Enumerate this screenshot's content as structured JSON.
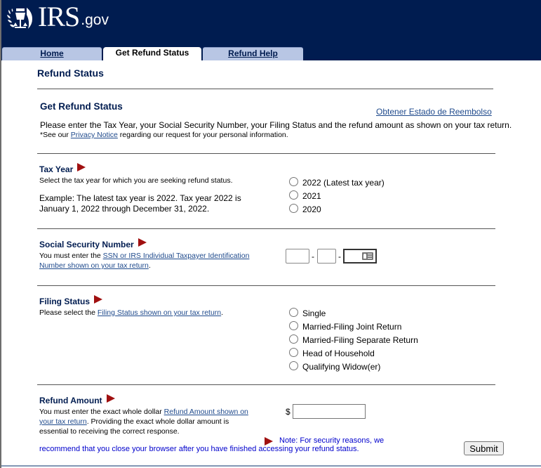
{
  "header": {
    "logo_text": "IRS",
    "logo_suffix": ".gov",
    "logo_icon": "irs-eagle-icon",
    "colors": {
      "navy": "#001c50",
      "tab_inactive": "#b8c6e4",
      "arrow_red": "#a01010",
      "link": "#1f4a8c",
      "note_blue": "#0000cc"
    }
  },
  "tabs": [
    {
      "label": "Home",
      "active": false
    },
    {
      "label": "Get Refund Status",
      "active": true
    },
    {
      "label": "Refund Help",
      "active": false
    }
  ],
  "page": {
    "title": "Refund Status",
    "section_title": "Get Refund Status",
    "spanish_link": "Obtener Estado de Reembolso",
    "intro": "Please enter the Tax Year, your Social Security Number, your Filing Status and the refund amount as shown on your tax return.",
    "privacy_prefix": "*See our ",
    "privacy_link": "Privacy Notice",
    "privacy_suffix": " regarding our request for your personal information."
  },
  "tax_year": {
    "label": "Tax Year",
    "help": "Select the tax year for which you are seeking refund status.",
    "example_line1": "Example: The latest tax year is 2022. Tax year 2022 is",
    "example_line2": "January 1, 2022 through December 31, 2022.",
    "options": [
      "2022 (Latest tax year)",
      "2021",
      "2020"
    ]
  },
  "ssn": {
    "label": "Social Security Number",
    "help_prefix": "You must enter the ",
    "help_link_line1": "SSN or IRS Individual Taxpayer Identification",
    "help_link_line2": "Number shown on your tax return",
    "help_suffix": ".",
    "separator": "-",
    "fields": [
      "",
      "",
      ""
    ]
  },
  "filing_status": {
    "label": "Filing Status",
    "help_prefix": "Please select the ",
    "help_link": "Filing Status shown on your tax return",
    "help_suffix": ".",
    "options": [
      "Single",
      "Married-Filing Joint Return",
      "Married-Filing Separate Return",
      "Head of Household",
      "Qualifying Widow(er)"
    ]
  },
  "refund_amount": {
    "label": "Refund Amount",
    "help_prefix": "You must enter the exact whole dollar ",
    "help_link_line1": "Refund Amount shown on",
    "help_link_line2": "your tax return",
    "help_rest_line2": ". Providing the exact whole dollar amount is",
    "help_line3": "essential to receiving the correct response.",
    "currency": "$",
    "value": ""
  },
  "footer": {
    "note_line1": "Note: For security reasons, we",
    "note_line2": "recommend that you close your browser after you have finished accessing your refund status.",
    "submit_label": "Submit"
  }
}
